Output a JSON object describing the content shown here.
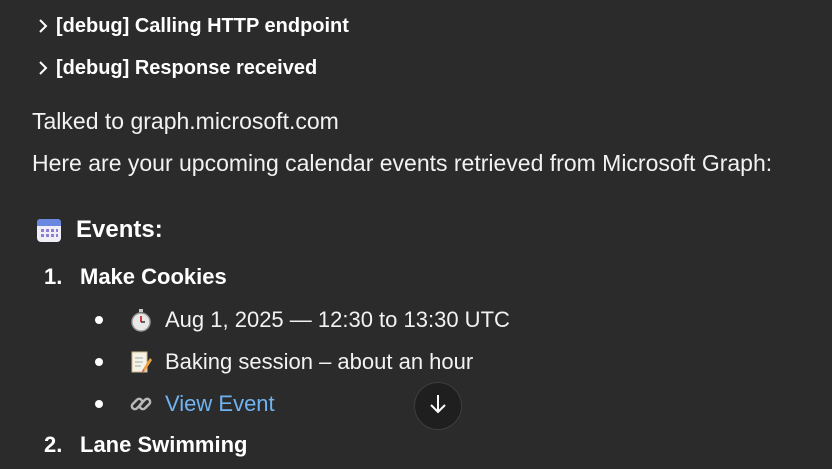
{
  "debug": [
    {
      "label": "[debug] Calling HTTP endpoint"
    },
    {
      "label": "[debug] Response received"
    }
  ],
  "messages": {
    "talked_to": "Talked to graph.microsoft.com",
    "intro": "Here are your upcoming calendar events retrieved from Microsoft Graph:"
  },
  "events_heading": "Events:",
  "events": [
    {
      "number": "1.",
      "title": "Make Cookies",
      "time": "Aug 1, 2025 — 12:30 to 13:30 UTC",
      "note": "Baking session – about an hour",
      "link_label": "View Event"
    },
    {
      "number": "2.",
      "title": "Lane Swimming"
    }
  ],
  "icons": {
    "debug_chevron": "chevron-right-icon",
    "heading": "calendar-icon",
    "time": "stopwatch-icon",
    "note": "memo-icon",
    "link": "link-icon",
    "scroll": "arrow-down-icon"
  },
  "colors": {
    "background": "#2b2b2b",
    "link": "#6fb3f2",
    "text": "#ffffff"
  }
}
